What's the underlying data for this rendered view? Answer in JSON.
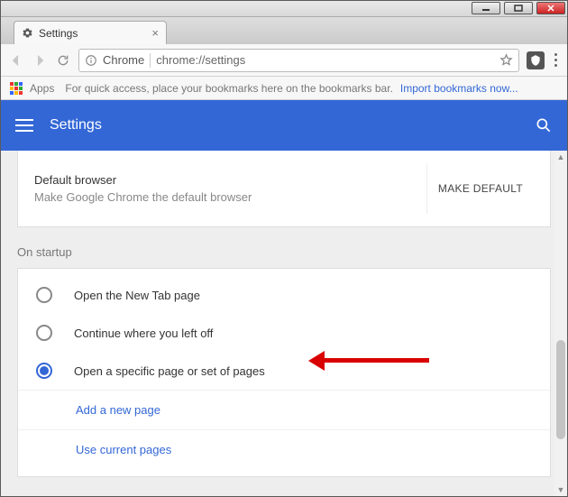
{
  "window": {
    "tab_title": "Settings"
  },
  "nav": {
    "security_label": "Chrome",
    "url": "chrome://settings"
  },
  "bookmarks_bar": {
    "apps_label": "Apps",
    "hint": "For quick access, place your bookmarks here on the bookmarks bar.",
    "import_link": "Import bookmarks now..."
  },
  "header": {
    "title": "Settings"
  },
  "default_browser": {
    "title": "Default browser",
    "subtitle": "Make Google Chrome the default browser",
    "button": "MAKE DEFAULT"
  },
  "startup": {
    "section_title": "On startup",
    "options": [
      {
        "label": "Open the New Tab page",
        "selected": false
      },
      {
        "label": "Continue where you left off",
        "selected": false
      },
      {
        "label": "Open a specific page or set of pages",
        "selected": true
      }
    ],
    "add_page": "Add a new page",
    "use_current": "Use current pages"
  }
}
